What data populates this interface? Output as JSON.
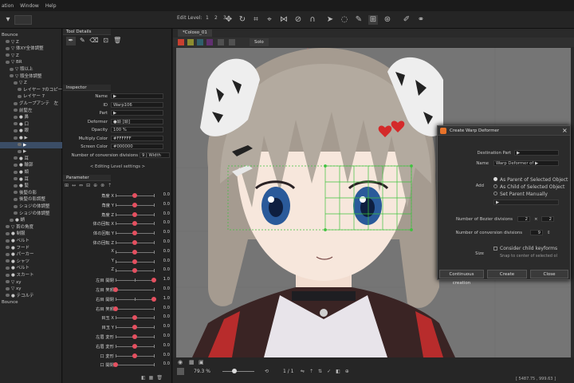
{
  "menu": {
    "items": [
      "ation",
      "Window",
      "Help"
    ]
  },
  "toolbar": {
    "edit_level_label": "Edit Level:",
    "levels": [
      "1",
      "2",
      "3"
    ]
  },
  "left": {
    "tree": [
      {
        "label": "Bounce",
        "indent": 0,
        "eye": false
      },
      {
        "label": "▽ Z",
        "indent": 1,
        "eye": true
      },
      {
        "label": "▽ 体XY全体調整",
        "indent": 1,
        "eye": true
      },
      {
        "label": "▽ Z",
        "indent": 1,
        "eye": true
      },
      {
        "label": "▽ BR",
        "indent": 1,
        "eye": true
      },
      {
        "label": "▽ 頭以上",
        "indent": 2,
        "eye": true
      },
      {
        "label": "▽ 頭全体調整",
        "indent": 2,
        "eye": true
      },
      {
        "label": "▽ Z",
        "indent": 3,
        "eye": true
      },
      {
        "label": "レイヤー 7のコピー",
        "indent": 4,
        "eye": true
      },
      {
        "label": "レイヤー 7",
        "indent": 4,
        "eye": true
      },
      {
        "label": "グループアンテ　左",
        "indent": 3,
        "eye": true
      },
      {
        "label": "前髪左",
        "indent": 3,
        "eye": true
      },
      {
        "label": "● 鼻",
        "indent": 3,
        "eye": true
      },
      {
        "label": "● 口",
        "indent": 3,
        "eye": true
      },
      {
        "label": "● 眼",
        "indent": 3,
        "eye": true
      },
      {
        "label": "● ▶",
        "indent": 3,
        "eye": true
      },
      {
        "label": "▶",
        "indent": 4,
        "eye": true,
        "selected": true
      },
      {
        "label": "▶",
        "indent": 4,
        "eye": true
      },
      {
        "label": "● 耳",
        "indent": 3,
        "eye": true
      },
      {
        "label": "● 輪郭",
        "indent": 3,
        "eye": true
      },
      {
        "label": "● 頬",
        "indent": 3,
        "eye": true
      },
      {
        "label": "● 耳",
        "indent": 3,
        "eye": true
      },
      {
        "label": "● 髪",
        "indent": 3,
        "eye": true
      },
      {
        "label": "後髪の影",
        "indent": 3,
        "eye": true
      },
      {
        "label": "後髪の影調整",
        "indent": 3,
        "eye": true
      },
      {
        "label": "ショジの体調整",
        "indent": 3,
        "eye": true
      },
      {
        "label": "ショジの体調整",
        "indent": 3,
        "eye": true
      },
      {
        "label": "● 蛸",
        "indent": 2,
        "eye": true
      },
      {
        "label": "▽ 首の角度",
        "indent": 1,
        "eye": true
      },
      {
        "label": "● 制服",
        "indent": 1,
        "eye": true
      },
      {
        "label": "● ベルト",
        "indent": 1,
        "eye": true
      },
      {
        "label": "● フード",
        "indent": 1,
        "eye": true
      },
      {
        "label": "● パーカー",
        "indent": 1,
        "eye": true
      },
      {
        "label": "● シャツ",
        "indent": 1,
        "eye": true
      },
      {
        "label": "● ベルト",
        "indent": 1,
        "eye": true
      },
      {
        "label": "● スカート",
        "indent": 1,
        "eye": true
      },
      {
        "label": "▽ xy",
        "indent": 1,
        "eye": true
      },
      {
        "label": "▽ xy",
        "indent": 1,
        "eye": true
      },
      {
        "label": "● テコルテ",
        "indent": 1,
        "eye": true
      },
      {
        "label": "Bounce",
        "indent": 0,
        "eye": false
      }
    ]
  },
  "tool_details": {
    "title": "Tool Details"
  },
  "inspector": {
    "title": "Inspector",
    "rows": [
      {
        "label": "Name",
        "value": "▶"
      },
      {
        "label": "ID",
        "value": "Warp106"
      },
      {
        "label": "Part",
        "value": "▶"
      },
      {
        "label": "Deformer",
        "value": "●頭 [頭]"
      },
      {
        "label": "Opacity",
        "value": "100 %"
      },
      {
        "label": "Multiply Color",
        "value": "#FFFFFF"
      },
      {
        "label": "Screen Color",
        "value": "#000000"
      },
      {
        "label": "Number of conversion divisions",
        "value": "9 | Width"
      }
    ],
    "editing_level": "< Editing Level settings >"
  },
  "parameter": {
    "title": "Parameter",
    "rows": [
      {
        "name": "角度 X",
        "value": "0.0",
        "knob": 0.5,
        "ticks": 3
      },
      {
        "name": "角度 Y",
        "value": "0.0",
        "knob": 0.5,
        "ticks": 3
      },
      {
        "name": "角度 Z",
        "value": "0.0",
        "knob": 0.5,
        "ticks": 3
      },
      {
        "name": "体の回転 X",
        "value": "0.0",
        "knob": 0.5,
        "ticks": 3
      },
      {
        "name": "体の回転 Y",
        "value": "0.0",
        "knob": 0.5,
        "ticks": 3
      },
      {
        "name": "体の回転 Z",
        "value": "0.0",
        "knob": 0.5,
        "ticks": 3
      },
      {
        "name": "X",
        "value": "0.0",
        "knob": 0.5,
        "ticks": 3
      },
      {
        "name": "Y",
        "value": "0.0",
        "knob": 0.5,
        "ticks": 3
      },
      {
        "name": "Z",
        "value": "0.0",
        "knob": 0.5,
        "ticks": 3
      },
      {
        "name": "左目 開閉",
        "value": "1.0",
        "knob": 1.0,
        "ticks": 3
      },
      {
        "name": "左目 笑顔",
        "value": "0.0",
        "knob": 0.0,
        "ticks": 2
      },
      {
        "name": "右目 開閉",
        "value": "1.0",
        "knob": 1.0,
        "ticks": 3
      },
      {
        "name": "右目 笑顔",
        "value": "0.0",
        "knob": 0.0,
        "ticks": 2
      },
      {
        "name": "目玉 X",
        "value": "0.0",
        "knob": 0.5,
        "ticks": 3
      },
      {
        "name": "目玉 Y",
        "value": "0.0",
        "knob": 0.5,
        "ticks": 3
      },
      {
        "name": "左眉 変形",
        "value": "0.0",
        "knob": 0.5,
        "ticks": 3
      },
      {
        "name": "右眉 変形",
        "value": "0.0",
        "knob": 0.5,
        "ticks": 3
      },
      {
        "name": "口 変形",
        "value": "0.0",
        "knob": 0.5,
        "ticks": 3
      },
      {
        "name": "口 開閉",
        "value": "0.0",
        "knob": 0.0,
        "ticks": 2
      }
    ]
  },
  "document": {
    "tab": "*Coloso_01",
    "view_label": "Solo"
  },
  "statusbar": {
    "zoom": "79.3 %",
    "page": "1 / 1",
    "coords": "[ 5487.75 , 999.63 ]"
  },
  "dialog": {
    "title": "Create Warp Deformer",
    "destination_part_label": "Destination Part",
    "destination_part_value": "▶",
    "name_label": "Name",
    "name_value": "Warp Deformer of ▶",
    "add_label": "Add",
    "add_options": [
      "As Parent of Selected Object",
      "As Child of Selected Object",
      "Set Parent Manually"
    ],
    "add_selected": 0,
    "parent_placeholder": "▶",
    "bezier_label": "Number of Bezier divisions",
    "bezier_x": "2",
    "bezier_y": "2",
    "conversion_label": "Number of conversion divisions",
    "conversion_value": "9",
    "size_label": "Size",
    "consider_child": "Consider child keyforms",
    "snap_text": "Snap to center of selected ol",
    "btn_continuous": "Continuous creation",
    "btn_create": "Create",
    "btn_close": "Close",
    "times": "×"
  },
  "colors": {
    "accent": "#e55060",
    "selection": "#3b4d66",
    "warp_grid": "#3ec23e",
    "canvas_bg": "#757575",
    "dialog_icon": "#e8732a"
  },
  "icons": [
    "select-icon",
    "lasso-icon",
    "brush-icon",
    "eraser-icon",
    "deformer-warp-icon",
    "deformer-rotation-icon",
    "pen-icon",
    "lock-icon",
    "trash-icon",
    "eye-icon",
    "camera-icon"
  ]
}
